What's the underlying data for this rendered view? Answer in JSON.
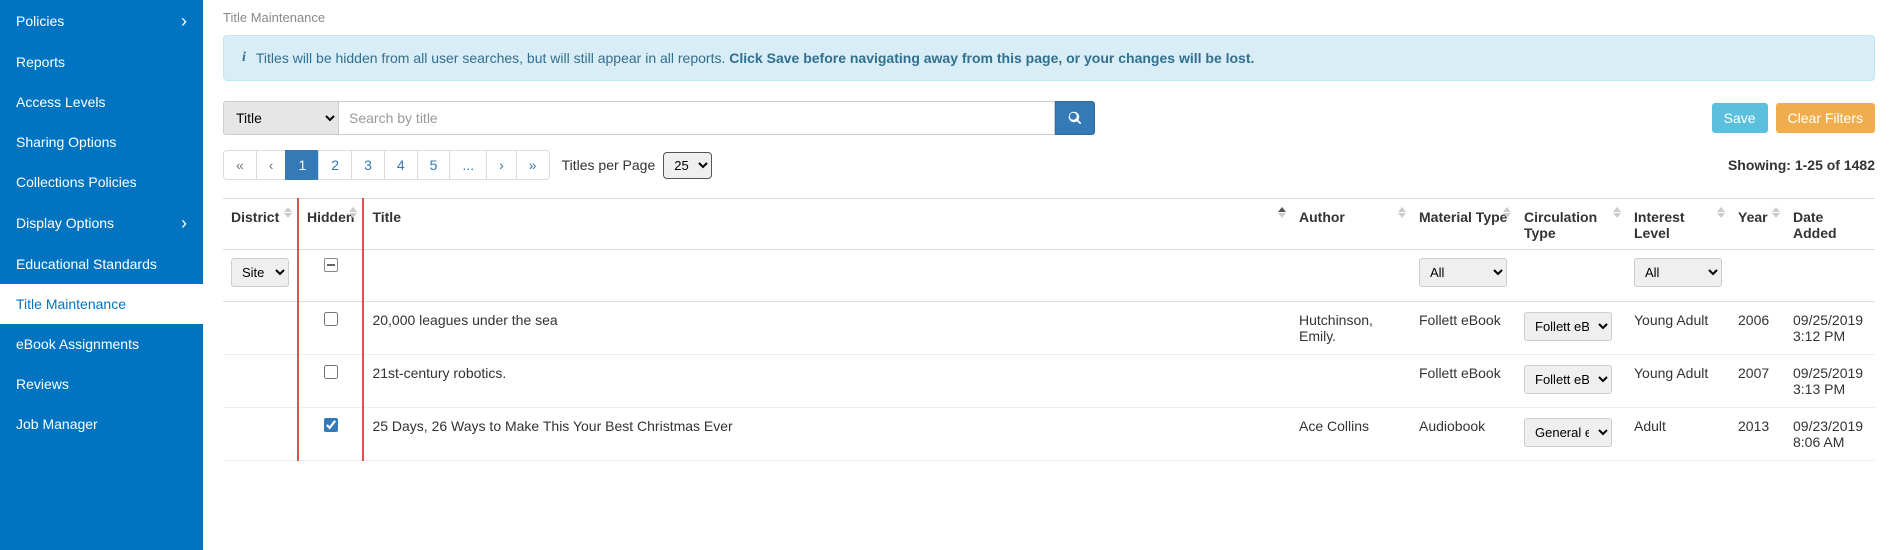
{
  "sidebar": {
    "items": [
      {
        "label": "Policies",
        "chevron": true,
        "active": false
      },
      {
        "label": "Reports",
        "chevron": false,
        "active": false
      },
      {
        "label": "Access Levels",
        "chevron": false,
        "active": false
      },
      {
        "label": "Sharing Options",
        "chevron": false,
        "active": false
      },
      {
        "label": "Collections Policies",
        "chevron": false,
        "active": false
      },
      {
        "label": "Display Options",
        "chevron": true,
        "active": false
      },
      {
        "label": "Educational Standards",
        "chevron": false,
        "active": false
      },
      {
        "label": "Title Maintenance",
        "chevron": false,
        "active": true
      },
      {
        "label": "eBook Assignments",
        "chevron": false,
        "active": false
      },
      {
        "label": "Reviews",
        "chevron": false,
        "active": false
      },
      {
        "label": "Job Manager",
        "chevron": false,
        "active": false
      }
    ]
  },
  "page_title": "Title Maintenance",
  "alert": {
    "text": "Titles will be hidden from all user searches, but will still appear in all reports. ",
    "bold": "Click Save before navigating away from this page, or your changes will be lost."
  },
  "search": {
    "field": "Title",
    "placeholder": "Search by title"
  },
  "buttons": {
    "save": "Save",
    "clear": "Clear Filters"
  },
  "pagination": {
    "pages": [
      "«",
      "‹",
      "1",
      "2",
      "3",
      "4",
      "5",
      "...",
      "›",
      "»"
    ],
    "active_index": 2,
    "per_page_label": "Titles per Page",
    "per_page_value": "25",
    "showing": "Showing: 1-25 of 1482"
  },
  "columns": {
    "district": "District",
    "hidden": "Hidden",
    "title": "Title",
    "author": "Author",
    "material_type": "Material Type",
    "circulation_type": "Circulation Type",
    "interest_level": "Interest Level",
    "year": "Year",
    "date_added": "Date Added"
  },
  "filters": {
    "site": "Site",
    "material_type_all": "All",
    "interest_level_all": "All"
  },
  "rows": [
    {
      "hidden": false,
      "title": "20,000 leagues under the sea",
      "author": "Hutchinson, Emily.",
      "material_type": "Follett eBook",
      "circulation_type": "Follett eBook",
      "interest_level": "Young Adult",
      "year": "2006",
      "date_added_line1": "09/25/2019",
      "date_added_line2": "3:12 PM"
    },
    {
      "hidden": false,
      "title": "21st-century robotics.",
      "author": "",
      "material_type": "Follett eBook",
      "circulation_type": "Follett eBook",
      "interest_level": "Young Adult",
      "year": "2007",
      "date_added_line1": "09/25/2019",
      "date_added_line2": "3:13 PM"
    },
    {
      "hidden": true,
      "title": "25 Days, 26 Ways to Make This Your Best Christmas Ever",
      "author": "Ace Collins",
      "material_type": "Audiobook",
      "circulation_type": "General eBook",
      "interest_level": "Adult",
      "year": "2013",
      "date_added_line1": "09/23/2019",
      "date_added_line2": "8:06 AM"
    }
  ]
}
